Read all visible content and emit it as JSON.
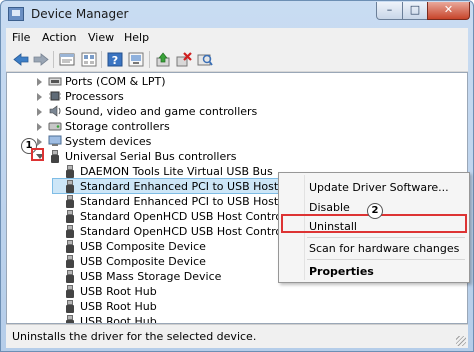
{
  "window": {
    "title": "Device Manager",
    "controls": {
      "minimize": "–",
      "maximize": "□",
      "close": "✕"
    }
  },
  "menu": [
    "File",
    "Action",
    "View",
    "Help"
  ],
  "toolbar": {
    "icons": [
      "back-arrow-icon",
      "forward-arrow-icon",
      "device-properties-icon",
      "show-hidden-icon",
      "help-icon",
      "computer-view-icon",
      "update-driver-icon",
      "uninstall-device-icon",
      "scan-hardware-icon"
    ]
  },
  "tree": {
    "categories": [
      {
        "label": "Ports (COM & LPT)",
        "icon": "port-icon"
      },
      {
        "label": "Processors",
        "icon": "processor-icon"
      },
      {
        "label": "Sound, video and game controllers",
        "icon": "speaker-icon"
      },
      {
        "label": "Storage controllers",
        "icon": "storage-icon"
      },
      {
        "label": "System devices",
        "icon": "system-devices-icon"
      },
      {
        "label": "Universal Serial Bus controllers",
        "icon": "usb-icon"
      }
    ],
    "usb_devices": [
      "DAEMON Tools Lite Virtual USB Bus",
      "Standard Enhanced PCI to USB Host Controller",
      "Standard Enhanced PCI to USB Host Controller",
      "Standard OpenHCD USB Host Controller",
      "Standard OpenHCD USB Host Controller",
      "USB Composite Device",
      "USB Composite Device",
      "USB Mass Storage Device",
      "USB Root Hub",
      "USB Root Hub",
      "USB Root Hub"
    ]
  },
  "context_menu": {
    "update": "Update Driver Software...",
    "disable": "Disable",
    "uninstall": "Uninstall",
    "scan": "Scan for hardware changes",
    "properties": "Properties"
  },
  "callouts": {
    "step1": "1",
    "step2": "2"
  },
  "status": {
    "text": "Uninstalls the driver for the selected device."
  },
  "colors": {
    "selection": "#cde6f7",
    "highlight_box": "#dd3333",
    "title_bar": "#c9dcf2"
  }
}
